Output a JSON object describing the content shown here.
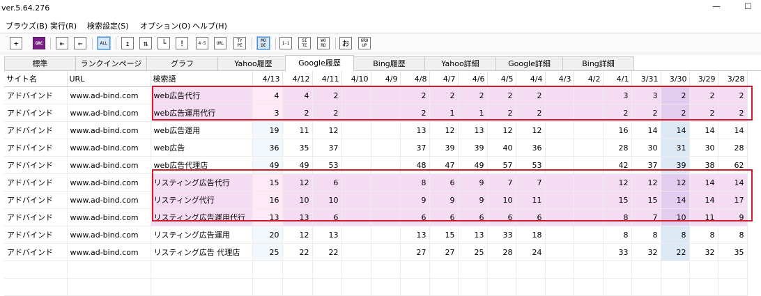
{
  "window": {
    "version": "ver.5.64.276",
    "minimize": "—",
    "maximize": "☐"
  },
  "menu": [
    "ブラウズ(B)",
    "実行(R)",
    "検索設定(S)",
    "オプション(O)",
    "ヘルプ(H)"
  ],
  "toolbar": {
    "add": "+",
    "grc": "GRC",
    "first": "⇤",
    "back": "←",
    "all": "ALL",
    "up": "↥",
    "updown": "⇅",
    "bracket": "└",
    "exclaim": "!",
    "range": "4·5",
    "url": "URL",
    "type": "TY PE",
    "mode": "MO DE",
    "one": "1-1",
    "site": "SI TE",
    "word": "WO RD",
    "o": "お",
    "group": "GRO UP"
  },
  "tabs": [
    "標準",
    "ランクインページ",
    "グラフ",
    "Yahoo履歴",
    "Google履歴",
    "Bing履歴",
    "Yahoo詳細",
    "Google詳細",
    "Bing詳細"
  ],
  "active_tab": "Google履歴",
  "table": {
    "headers": [
      "サイト名",
      "URL",
      "検索語",
      "4/13",
      "4/12",
      "4/11",
      "4/10",
      "4/9",
      "4/8",
      "4/7",
      "4/6",
      "4/5",
      "4/4",
      "4/3",
      "4/2",
      "4/1",
      "3/31",
      "3/30",
      "3/29",
      "3/28"
    ],
    "rows": [
      {
        "site": "アドバインド",
        "url": "www.ad-bind.com",
        "keyword": "web広告代行",
        "ranks": [
          "4",
          "4",
          "2",
          "",
          "",
          "2",
          "2",
          "2",
          "2",
          "2",
          "",
          "",
          "3",
          "3",
          "2",
          "2",
          "2"
        ],
        "highlight": true
      },
      {
        "site": "アドバインド",
        "url": "www.ad-bind.com",
        "keyword": "web広告運用代行",
        "ranks": [
          "3",
          "2",
          "2",
          "",
          "",
          "2",
          "1",
          "1",
          "2",
          "2",
          "",
          "",
          "2",
          "2",
          "2",
          "2",
          "2"
        ],
        "highlight": true
      },
      {
        "site": "アドバインド",
        "url": "www.ad-bind.com",
        "keyword": "web広告運用",
        "ranks": [
          "19",
          "11",
          "12",
          "",
          "",
          "13",
          "12",
          "13",
          "12",
          "12",
          "",
          "",
          "16",
          "14",
          "14",
          "14",
          "14"
        ],
        "highlight": false
      },
      {
        "site": "アドバインド",
        "url": "www.ad-bind.com",
        "keyword": "web広告",
        "ranks": [
          "36",
          "35",
          "37",
          "",
          "",
          "37",
          "39",
          "39",
          "40",
          "36",
          "",
          "",
          "28",
          "30",
          "31",
          "30",
          "28"
        ],
        "highlight": false
      },
      {
        "site": "アドバインド",
        "url": "www.ad-bind.com",
        "keyword": "web広告代理店",
        "ranks": [
          "49",
          "49",
          "53",
          "",
          "",
          "48",
          "47",
          "49",
          "57",
          "53",
          "",
          "",
          "42",
          "37",
          "39",
          "38",
          "62"
        ],
        "highlight": false
      },
      {
        "site": "アドバインド",
        "url": "www.ad-bind.com",
        "keyword": "リスティング広告代行",
        "ranks": [
          "15",
          "12",
          "6",
          "",
          "",
          "8",
          "6",
          "9",
          "7",
          "7",
          "",
          "",
          "12",
          "12",
          "12",
          "14",
          "14"
        ],
        "highlight": true
      },
      {
        "site": "アドバインド",
        "url": "www.ad-bind.com",
        "keyword": "リスティング代行",
        "ranks": [
          "16",
          "10",
          "10",
          "",
          "",
          "9",
          "9",
          "9",
          "10",
          "11",
          "",
          "",
          "15",
          "15",
          "14",
          "14",
          "17"
        ],
        "highlight": true
      },
      {
        "site": "アドバインド",
        "url": "www.ad-bind.com",
        "keyword": "リスティング広告運用代行",
        "ranks": [
          "13",
          "13",
          "6",
          "",
          "",
          "6",
          "6",
          "6",
          "6",
          "6",
          "",
          "",
          "8",
          "7",
          "10",
          "11",
          "9"
        ],
        "highlight": true
      },
      {
        "site": "アドバインド",
        "url": "www.ad-bind.com",
        "keyword": "リスティング広告運用",
        "ranks": [
          "20",
          "12",
          "13",
          "",
          "",
          "13",
          "15",
          "13",
          "33",
          "18",
          "",
          "",
          "8",
          "8",
          "8",
          "8",
          "8"
        ],
        "highlight": false
      },
      {
        "site": "アドバインド",
        "url": "www.ad-bind.com",
        "keyword": "リスティング広告 代理店",
        "ranks": [
          "25",
          "22",
          "22",
          "",
          "",
          "27",
          "27",
          "25",
          "28",
          "24",
          "",
          "",
          "33",
          "32",
          "22",
          "32",
          "35"
        ],
        "highlight": false
      }
    ]
  },
  "colors": {
    "highlight_bg": "#f6dcf2",
    "highlight_border": "#d11a2a",
    "grc_purple": "#7a1f86"
  }
}
